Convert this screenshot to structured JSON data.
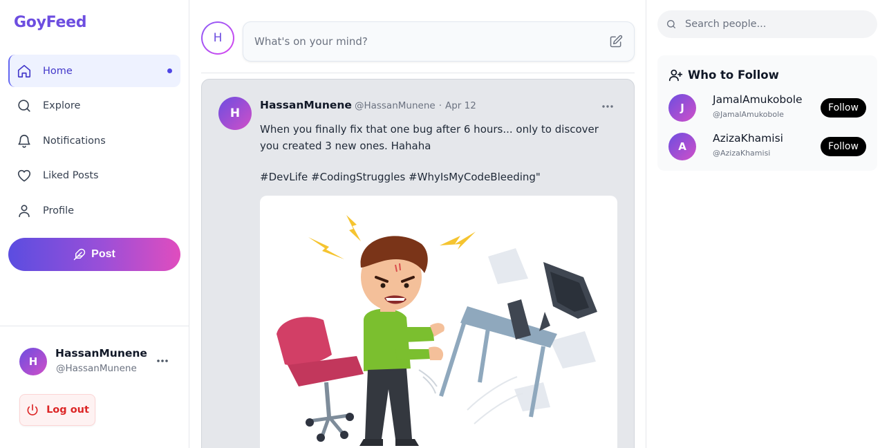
{
  "app": {
    "logo": "GoyFeed"
  },
  "nav": {
    "items": [
      {
        "label": "Home",
        "icon": "home-icon",
        "active": true
      },
      {
        "label": "Explore",
        "icon": "search-icon",
        "active": false
      },
      {
        "label": "Notifications",
        "icon": "bell-icon",
        "active": false
      },
      {
        "label": "Liked Posts",
        "icon": "heart-icon",
        "active": false
      },
      {
        "label": "Profile",
        "icon": "user-icon",
        "active": false
      }
    ],
    "post_button": "Post"
  },
  "current_user": {
    "initial": "H",
    "name": "HassanMunene",
    "handle": "@HassanMunene",
    "logout_label": "Log out"
  },
  "composer": {
    "avatar_initial": "H",
    "placeholder": "What's on your mind?"
  },
  "post": {
    "avatar_initial": "H",
    "author": "HassanMunene",
    "handle": "@HassanMunene",
    "separator": "·",
    "date": "Apr 12",
    "text": "When you finally fix that one bug after 6 hours... only to discover you created 3 new ones. Hahaha",
    "tags": "#DevLife #CodingStruggles #WhyIsMyCodeBleeding\""
  },
  "search": {
    "placeholder": "Search people..."
  },
  "who_to_follow": {
    "title": "Who to Follow",
    "users": [
      {
        "initial": "J",
        "name": "JamalAmukobole",
        "handle": "@JamalAmukobole",
        "button": "Follow"
      },
      {
        "initial": "A",
        "name": "AzizaKhamisi",
        "handle": "@AzizaKhamisi",
        "button": "Follow"
      }
    ]
  },
  "colors": {
    "brand": "#6d4ee0",
    "accent_gradient_start": "#5b4de0",
    "accent_gradient_end": "#e04dbe",
    "logout_red": "#dc2626"
  }
}
